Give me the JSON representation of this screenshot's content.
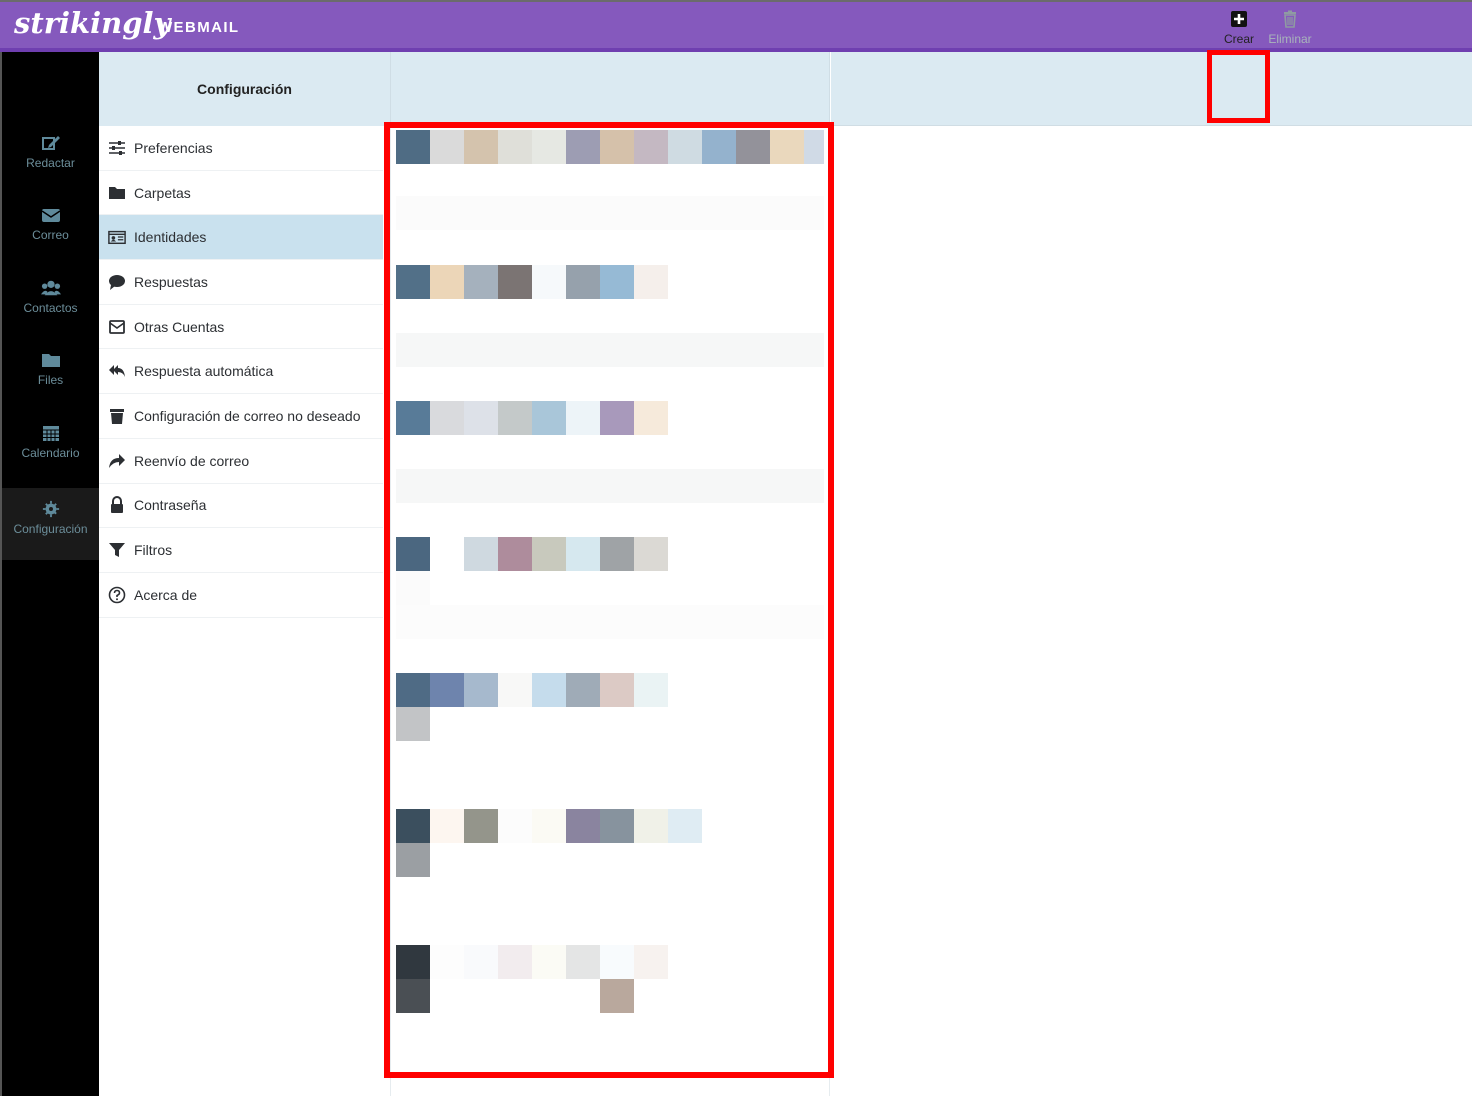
{
  "header": {
    "brand": "strikingly",
    "product": "WEBMAIL"
  },
  "leftnav": {
    "items": [
      {
        "id": "compose",
        "label": "Redactar",
        "icon": "compose-icon"
      },
      {
        "id": "mail",
        "label": "Correo",
        "icon": "envelope-icon"
      },
      {
        "id": "contacts",
        "label": "Contactos",
        "icon": "users-icon"
      },
      {
        "id": "files",
        "label": "Files",
        "icon": "folder-icon"
      },
      {
        "id": "calendar",
        "label": "Calendario",
        "icon": "calendar-icon"
      },
      {
        "id": "settings",
        "label": "Configuración",
        "icon": "gear-icon",
        "active": true
      }
    ]
  },
  "settings": {
    "title": "Configuración",
    "items": [
      {
        "label": "Preferencias",
        "icon": "sliders-icon"
      },
      {
        "label": "Carpetas",
        "icon": "folder-icon"
      },
      {
        "label": "Identidades",
        "icon": "id-card-icon",
        "active": true
      },
      {
        "label": "Respuestas",
        "icon": "speech-bubble-icon"
      },
      {
        "label": "Otras Cuentas",
        "icon": "envelope-box-icon"
      },
      {
        "label": "Respuesta automática",
        "icon": "reply-all-icon"
      },
      {
        "label": "Configuración de correo no deseado",
        "icon": "trash-icon"
      },
      {
        "label": "Reenvío de correo",
        "icon": "forward-icon"
      },
      {
        "label": "Contraseña",
        "icon": "lock-icon"
      },
      {
        "label": "Filtros",
        "icon": "filter-icon"
      },
      {
        "label": "Acerca de",
        "icon": "question-circle-icon"
      }
    ]
  },
  "toolbar": {
    "create_label": "Crear",
    "delete_label": "Eliminar"
  },
  "colors": {
    "accent": "#8559bd",
    "highlight": "#ff0000",
    "panel": "#dbeaf2",
    "selected": "#c9e1ee"
  }
}
